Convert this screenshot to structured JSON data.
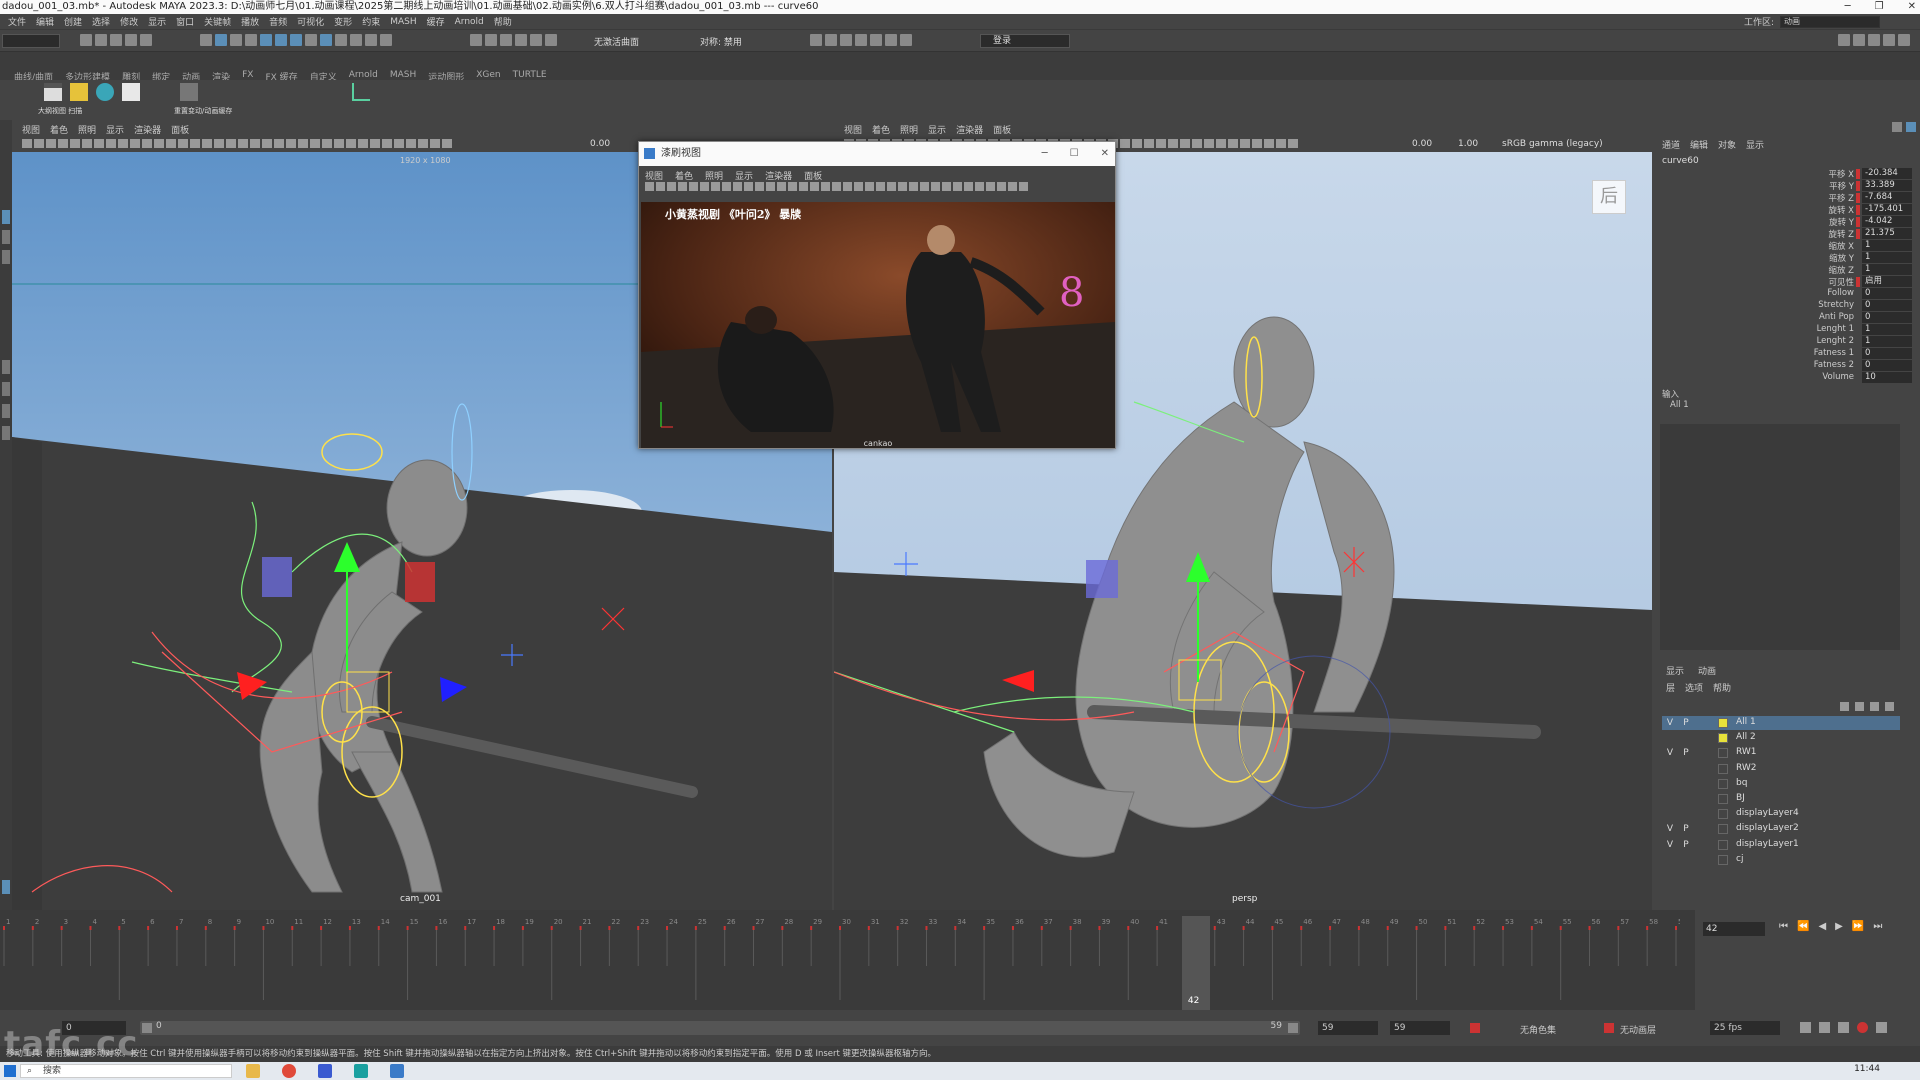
{
  "window": {
    "title": "dadou_001_03.mb* - Autodesk MAYA 2023.3: D:\\动画师七月\\01.动画课程\\2025第二期线上动画培训\\01.动画基础\\02.动画实例\\6.双人打斗组赛\\dadou_001_03.mb  ---  curve60"
  },
  "menubar": {
    "items": [
      "文件",
      "编辑",
      "创建",
      "选择",
      "修改",
      "显示",
      "窗口",
      "关键帧",
      "播放",
      "音频",
      "可视化",
      "变形",
      "约束",
      "MASH",
      "缓存",
      "Arnold",
      "帮助"
    ],
    "workspace_label": "工作区:",
    "workspace_value": "动画"
  },
  "statusline": {
    "snap_label": "无激活曲面",
    "symmetry_label": "对称: 禁用",
    "login_label": "登录"
  },
  "shelf": {
    "tabs": [
      "曲线/曲面",
      "多边形建模",
      "雕刻",
      "绑定",
      "动画",
      "渲染",
      "FX",
      "FX 缓存",
      "自定义",
      "Arnold",
      "MASH",
      "运动图形",
      "XGen",
      "TURTLE"
    ],
    "button_labels": [
      "大纲视图 扫描",
      "重置变动/动画缓存"
    ]
  },
  "left_viewport": {
    "menu": [
      "视图",
      "着色",
      "照明",
      "显示",
      "渲染器",
      "面板"
    ],
    "exposure": "0.00",
    "cam_label": "1920 x 1080",
    "camera_name": "cam_001"
  },
  "right_viewport": {
    "menu": [
      "视图",
      "着色",
      "照明",
      "显示",
      "渲染器",
      "面板"
    ],
    "exposure": "0.00",
    "gamma": "1.00",
    "color_space": "sRGB gamma (legacy)",
    "camera_name": "persp",
    "back_label": "后"
  },
  "float_window": {
    "title": "漆刷视图",
    "menu": [
      "视图",
      "着色",
      "照明",
      "显示",
      "渲染器",
      "面板"
    ],
    "caption": "小黄蒸视剧 《叶问2》 暴牍",
    "camera_name": "cankao"
  },
  "channel_box": {
    "tabs": [
      "通道",
      "编辑",
      "对象",
      "显示"
    ],
    "node": "curve60",
    "attrs": [
      {
        "name": "平移 X",
        "value": "-20.384"
      },
      {
        "name": "平移 Y",
        "value": "33.389"
      },
      {
        "name": "平移 Z",
        "value": "-7.684"
      },
      {
        "name": "旋转 X",
        "value": "-175.401"
      },
      {
        "name": "旋转 Y",
        "value": "-4.042"
      },
      {
        "name": "旋转 Z",
        "value": "21.375"
      },
      {
        "name": "缩放 X",
        "value": "1"
      },
      {
        "name": "缩放 Y",
        "value": "1"
      },
      {
        "name": "缩放 Z",
        "value": "1"
      },
      {
        "name": "可见性",
        "value": "启用"
      },
      {
        "name": "Follow",
        "value": "0"
      },
      {
        "name": "Stretchy",
        "value": "0"
      },
      {
        "name": "Anti Pop",
        "value": "0"
      },
      {
        "name": "Lenght 1",
        "value": "1"
      },
      {
        "name": "Lenght 2",
        "value": "1"
      },
      {
        "name": "Fatness 1",
        "value": "0"
      },
      {
        "name": "Fatness 2",
        "value": "0"
      },
      {
        "name": "Volume",
        "value": "10"
      }
    ],
    "inputs_label": "输入",
    "inputs_item": "All 1"
  },
  "layer_editor": {
    "tabs": [
      "显示",
      "动画"
    ],
    "menu": [
      "层",
      "选项",
      "帮助"
    ],
    "layers": [
      {
        "v": "V",
        "p": "P",
        "name": "All 1",
        "color": "#e8e23a",
        "selected": true
      },
      {
        "v": "",
        "p": "",
        "name": "All 2",
        "color": "#e8e23a",
        "selected": false
      },
      {
        "v": "V",
        "p": "P",
        "name": "RW1",
        "color": "",
        "selected": false
      },
      {
        "v": "",
        "p": "",
        "name": "RW2",
        "color": "",
        "selected": false
      },
      {
        "v": "",
        "p": "",
        "name": "bq",
        "color": "",
        "selected": false
      },
      {
        "v": "",
        "p": "",
        "name": "BJ",
        "color": "",
        "selected": false
      },
      {
        "v": "",
        "p": "",
        "name": "displayLayer4",
        "color": "",
        "selected": false
      },
      {
        "v": "V",
        "p": "P",
        "name": "displayLayer2",
        "color": "",
        "selected": false
      },
      {
        "v": "V",
        "p": "P",
        "name": "displayLayer1",
        "color": "",
        "selected": false
      },
      {
        "v": "",
        "p": "",
        "name": "cj",
        "color": "",
        "selected": false
      }
    ]
  },
  "timeline": {
    "start": 1,
    "end": 59,
    "current_frame": "42",
    "frame_field": "42"
  },
  "range_slider": {
    "start_field": "0",
    "inner_start": "0",
    "inner_end": "59",
    "end_a": "59",
    "end_b": "59",
    "character_set": "无角色集",
    "anim_layer": "无动画层",
    "fps": "25 fps"
  },
  "help_line": "移动工具: 使用操纵器移动对象。按住 Ctrl 键并使用操纵器手柄可以将移动约束到操纵器平面。按住 Shift 键并拖动操纵器轴以在指定方向上挤出对象。按住 Ctrl+Shift 键并拖动以将移动约束到指定平面。使用 D 或 Insert 键更改操纵器枢轴方向。",
  "watermark": "tafc.cc",
  "taskbar": {
    "search_placeholder": "搜索",
    "clock": "11:44"
  },
  "colors": {
    "maya_gray": "#444444",
    "sky": "#8fb4dc",
    "ground": "#3a3a3a",
    "selection_blue": "#4e6f8e",
    "key_red": "#cc3333"
  }
}
